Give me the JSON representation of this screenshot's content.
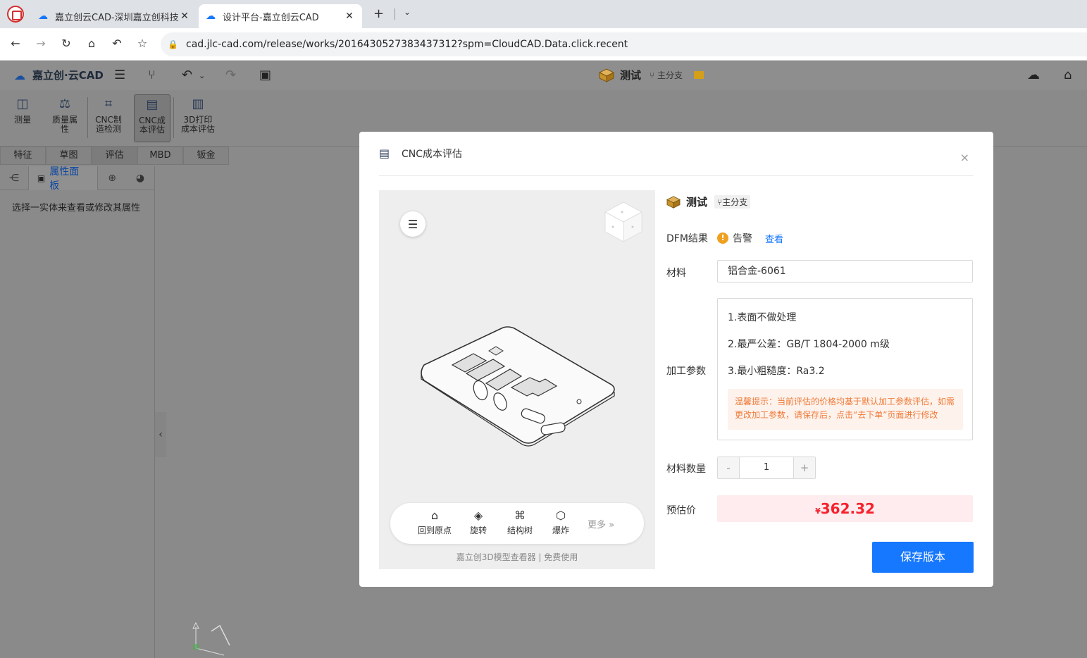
{
  "browser": {
    "tabs": [
      {
        "title": "嘉立创云CAD-深圳嘉立创科技",
        "active": false
      },
      {
        "title": "设计平台-嘉立创云CAD",
        "active": true
      }
    ],
    "url": "cad.jlc-cad.com/release/works/2016430527383437312?spm=CloudCAD.Data.click.recent"
  },
  "app": {
    "logo": "嘉立创·云CAD",
    "doc_title": "测试",
    "branch": "主分支"
  },
  "toolbar": {
    "tools": [
      "测量",
      "质量属性",
      "CNC制造检测",
      "CNC成本评估",
      "3D打印成本评估"
    ],
    "tool_lines": [
      [
        "测量"
      ],
      [
        "质量属",
        "性"
      ],
      [
        "CNC制",
        "造检测"
      ],
      [
        "CNC成",
        "本评估"
      ],
      [
        "3D打印",
        "成本评估"
      ]
    ],
    "ribbon_tabs": [
      "特征",
      "草图",
      "评估",
      "MBD",
      "钣金"
    ]
  },
  "left_panel": {
    "tab_label": "属性面板",
    "hint": "选择一实体来查看或修改其属性"
  },
  "modal": {
    "title": "CNC成本评估",
    "viewer": {
      "buttons": [
        "回到原点",
        "旋转",
        "结构树",
        "爆炸"
      ],
      "more": "更多 »",
      "footer": "嘉立创3D模型查看器 | 免费使用"
    },
    "form": {
      "name": "测试",
      "branch": "主分支",
      "dfm_label": "DFM结果",
      "dfm_status": "告警",
      "dfm_link": "查看",
      "material_label": "材料",
      "material_value": "铝合金-6061",
      "params_label": "加工参数",
      "params": [
        "1.表面不做处理",
        "2.最严公差：GB/T 1804-2000 m级",
        "3.最小粗糙度：Ra3.2"
      ],
      "tip": "温馨提示：当前评估的价格均基于默认加工参数评估，如需更改加工参数，请保存后，点击“去下单”页面进行修改",
      "qty_label": "材料数量",
      "qty_value": "1",
      "price_label": "预估价",
      "price_currency": "¥",
      "price_value": "362.32",
      "save_label": "保存版本"
    }
  },
  "colors": {
    "primary": "#1677ff",
    "price": "#f5222d",
    "warning": "#f0a020",
    "tip_text": "#f07a3a"
  }
}
